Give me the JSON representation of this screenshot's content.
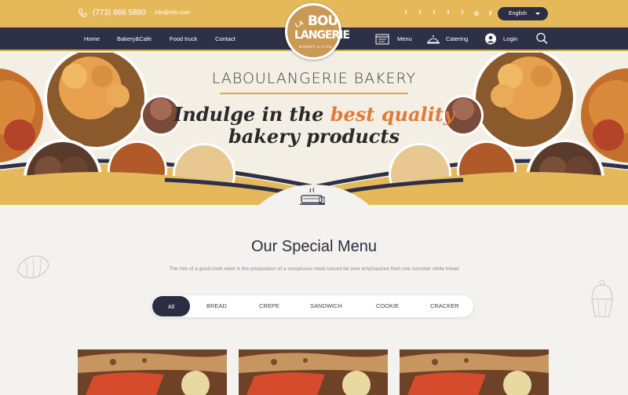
{
  "topbar": {
    "phone": "(773) 666 5880",
    "email": "info@info.com",
    "socials": [
      "f",
      "f",
      "t",
      "t",
      "t",
      "◎",
      "y"
    ],
    "language": "English"
  },
  "logo": {
    "la": "LA",
    "bou": "BOU",
    "langerie": "LANGERIE",
    "sub": "BAKERY & CAFE"
  },
  "nav": {
    "home": "Home",
    "bakery": "Bakery&Cafe",
    "foodtruck": "Food truck",
    "contact": "Contact",
    "menu": "Menu",
    "catering": "Catering",
    "login": "Login"
  },
  "hero": {
    "title": "LABOULANGERIE BAKERY",
    "tag_a": "Indulge in the ",
    "tag_hl": "best quality",
    "tag_b": "bakery products"
  },
  "section": {
    "title": "Our Special Menu",
    "subtitle": "The role of a good cook ware in the preparation of a sumptuous meal cannot be over emphasized then one consider white bread"
  },
  "tabs": [
    "All",
    "BREAD",
    "CREPE",
    "SANDWICH",
    "COOKIE",
    "CRACKER"
  ],
  "colors": {
    "gold": "#e5b95a",
    "navy": "#2e3047",
    "accent": "#e07b39"
  }
}
